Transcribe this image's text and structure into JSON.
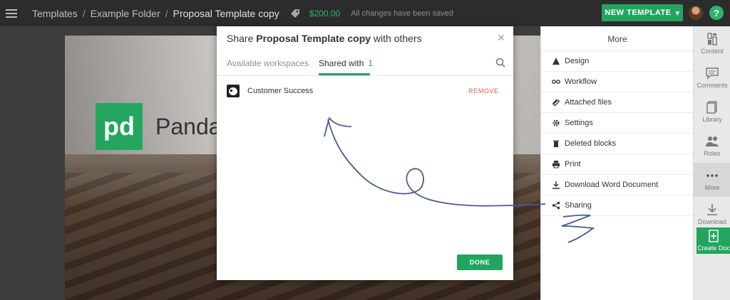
{
  "topbar": {
    "breadcrumbs": [
      "Templates",
      "Example Folder",
      "Proposal Template copy"
    ],
    "price": "$200.00",
    "status": "All changes have been saved",
    "new_template_label": "NEW TEMPLATE",
    "help_label": "?"
  },
  "document": {
    "logo_text": "pd",
    "brand_text": "Panda"
  },
  "modal": {
    "title_prefix": "Share",
    "title_doc": "Proposal Template copy",
    "title_suffix": "with others",
    "tabs": [
      {
        "label": "Available workspaces"
      },
      {
        "label": "Shared with",
        "count": "1"
      }
    ],
    "shared": [
      {
        "name": "Customer Success",
        "action": "REMOVE"
      }
    ],
    "done_label": "DONE"
  },
  "more_panel": {
    "title": "More",
    "items": [
      {
        "label": "Design",
        "icon": "design-icon"
      },
      {
        "label": "Workflow",
        "icon": "workflow-icon"
      },
      {
        "label": "Attached files",
        "icon": "paperclip-icon"
      },
      {
        "label": "Settings",
        "icon": "gear-icon"
      },
      {
        "label": "Deleted blocks",
        "icon": "trash-icon"
      },
      {
        "label": "Print",
        "icon": "printer-icon"
      },
      {
        "label": "Download Word Document",
        "icon": "download-icon"
      },
      {
        "label": "Sharing",
        "icon": "share-icon"
      }
    ]
  },
  "rail": {
    "items": [
      {
        "label": "Content",
        "icon": "content-icon"
      },
      {
        "label": "Comments",
        "icon": "comments-icon"
      },
      {
        "label": "Library",
        "icon": "library-icon"
      },
      {
        "label": "Roles",
        "icon": "roles-icon"
      },
      {
        "label": "More",
        "icon": "more-icon"
      },
      {
        "label": "Download",
        "icon": "download-icon"
      }
    ],
    "create_doc_label": "Create Doc"
  },
  "colors": {
    "accent": "#23a55f",
    "remove": "#e05a5a",
    "annotation": "#4a5a96"
  }
}
